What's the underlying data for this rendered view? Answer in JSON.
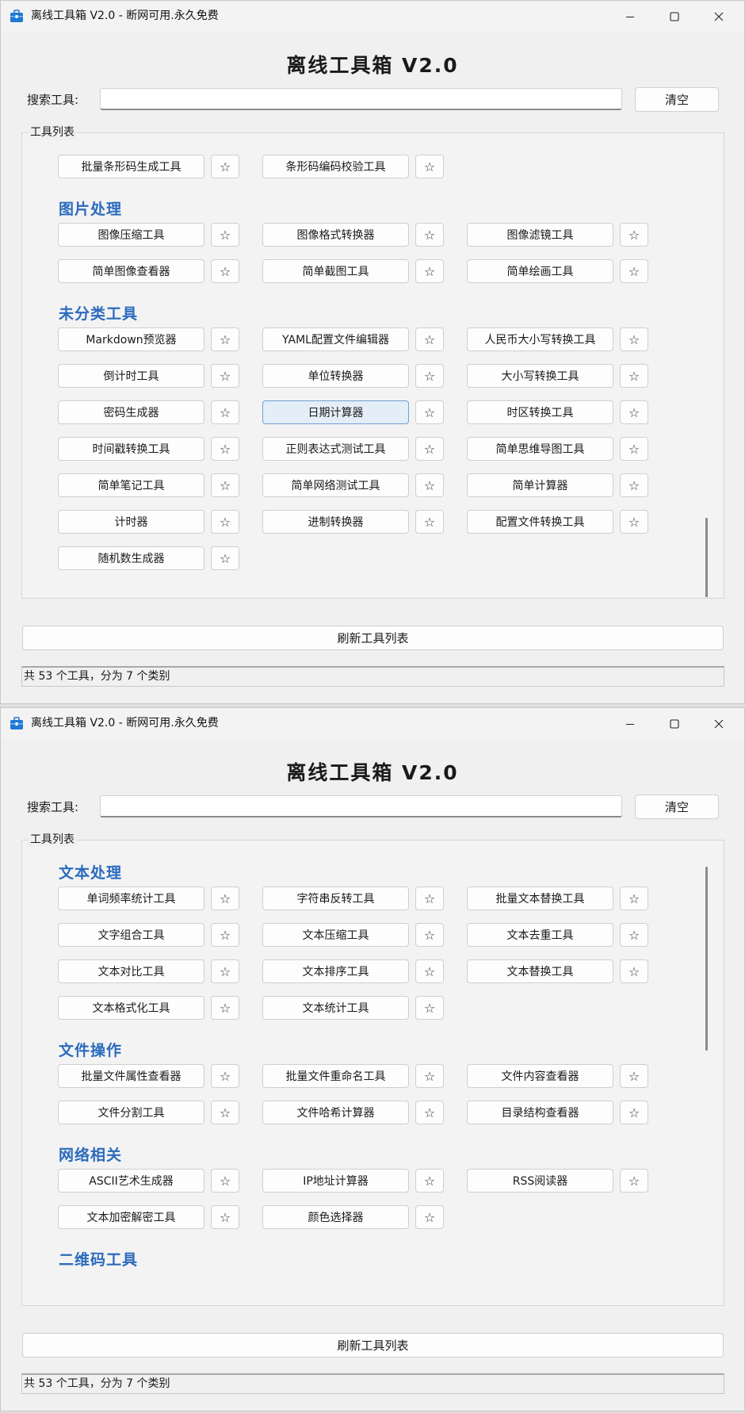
{
  "app": {
    "window_title": "离线工具箱 V2.0 - 断网可用.永久免费",
    "heading": "离线工具箱 V2.0",
    "search_label": "搜索工具:",
    "search_value": "",
    "clear_label": "清空",
    "group_title": "工具列表",
    "refresh_label": "刷新工具列表",
    "status": "共 53 个工具，分为 7 个类别",
    "star": "☆",
    "accent_color": "#2b6bbd"
  },
  "windows": [
    {
      "rows": [
        {
          "type": "tools",
          "items": [
            "批量条形码生成工具",
            "条形码编码校验工具"
          ]
        },
        {
          "type": "header",
          "label": "图片处理"
        },
        {
          "type": "tools",
          "items": [
            "图像压缩工具",
            "图像格式转换器",
            "图像滤镜工具"
          ]
        },
        {
          "type": "tools",
          "items": [
            "简单图像查看器",
            "简单截图工具",
            "简单绘画工具"
          ]
        },
        {
          "type": "header",
          "label": "未分类工具"
        },
        {
          "type": "tools",
          "items": [
            "Markdown预览器",
            "YAML配置文件编辑器",
            "人民币大小写转换工具"
          ]
        },
        {
          "type": "tools",
          "items": [
            "倒计时工具",
            "单位转换器",
            "大小写转换工具"
          ]
        },
        {
          "type": "tools",
          "items": [
            "密码生成器",
            "日期计算器",
            "时区转换工具"
          ],
          "active": 1
        },
        {
          "type": "tools",
          "items": [
            "时间戳转换工具",
            "正则表达式测试工具",
            "简单思维导图工具"
          ]
        },
        {
          "type": "tools",
          "items": [
            "简单笔记工具",
            "简单网络测试工具",
            "简单计算器"
          ]
        },
        {
          "type": "tools",
          "items": [
            "计时器",
            "进制转换器",
            "配置文件转换工具"
          ]
        },
        {
          "type": "tools",
          "items": [
            "随机数生成器"
          ]
        }
      ]
    },
    {
      "rows": [
        {
          "type": "header",
          "label": "文本处理"
        },
        {
          "type": "tools",
          "items": [
            "单词频率统计工具",
            "字符串反转工具",
            "批量文本替换工具"
          ]
        },
        {
          "type": "tools",
          "items": [
            "文字组合工具",
            "文本压缩工具",
            "文本去重工具"
          ]
        },
        {
          "type": "tools",
          "items": [
            "文本对比工具",
            "文本排序工具",
            "文本替换工具"
          ]
        },
        {
          "type": "tools",
          "items": [
            "文本格式化工具",
            "文本统计工具"
          ]
        },
        {
          "type": "header",
          "label": "文件操作"
        },
        {
          "type": "tools",
          "items": [
            "批量文件属性查看器",
            "批量文件重命名工具",
            "文件内容查看器"
          ]
        },
        {
          "type": "tools",
          "items": [
            "文件分割工具",
            "文件哈希计算器",
            "目录结构查看器"
          ]
        },
        {
          "type": "header",
          "label": "网络相关"
        },
        {
          "type": "tools",
          "items": [
            "ASCII艺术生成器",
            "IP地址计算器",
            "RSS阅读器"
          ]
        },
        {
          "type": "tools",
          "items": [
            "文本加密解密工具",
            "颜色选择器"
          ]
        },
        {
          "type": "header",
          "label": "二维码工具"
        }
      ]
    }
  ]
}
